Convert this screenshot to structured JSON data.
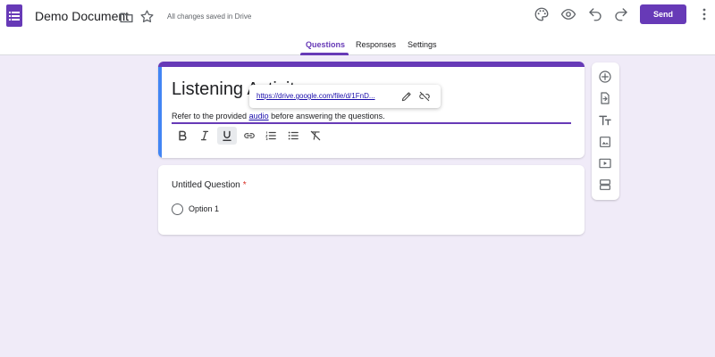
{
  "header": {
    "doc_title": "Demo Document",
    "save_status": "All changes saved in Drive",
    "send_label": "Send",
    "icons": [
      "app-logo-icon",
      "folder-icon",
      "star-icon",
      "palette-icon",
      "preview-eye-icon",
      "undo-icon",
      "redo-icon",
      "more-vert-icon"
    ]
  },
  "tabs": [
    {
      "label": "Questions",
      "active": true
    },
    {
      "label": "Responses",
      "active": false
    },
    {
      "label": "Settings",
      "active": false
    }
  ],
  "title_card": {
    "title": "Listening Activity",
    "description_before": "Refer to the provided ",
    "description_link": "audio",
    "description_after": " before answering the questions."
  },
  "link_popup": {
    "url": "https://drive.google.com/file/d/1FnD..."
  },
  "format_toolbar": {
    "items": [
      "bold-icon",
      "italic-icon",
      "underline-icon",
      "link-icon",
      "numbered-list-icon",
      "bulleted-list-icon",
      "clear-format-icon"
    ],
    "active": "underline-icon"
  },
  "question": {
    "title": "Untitled Question",
    "required_mark": "*",
    "options": [
      "Option 1"
    ]
  },
  "side_toolbar": {
    "items": [
      "add-question-icon",
      "import-questions-icon",
      "add-title-icon",
      "add-image-icon",
      "add-video-icon",
      "add-section-icon"
    ]
  },
  "colors": {
    "accent": "#673ab7",
    "background": "#f0ebf8",
    "focus_bar": "#4285f4",
    "required": "#d93025"
  }
}
